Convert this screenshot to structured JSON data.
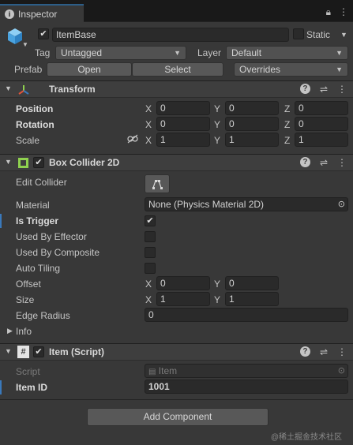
{
  "tab": {
    "title": "Inspector"
  },
  "gameobject": {
    "active": true,
    "name": "ItemBase",
    "static_label": "Static",
    "tag_label": "Tag",
    "tag_value": "Untagged",
    "layer_label": "Layer",
    "layer_value": "Default",
    "prefab_label": "Prefab",
    "open_label": "Open",
    "select_label": "Select",
    "overrides_label": "Overrides"
  },
  "transform": {
    "title": "Transform",
    "position_label": "Position",
    "rotation_label": "Rotation",
    "scale_label": "Scale",
    "position": {
      "x": "0",
      "y": "0",
      "z": "0"
    },
    "rotation": {
      "x": "0",
      "y": "0",
      "z": "0"
    },
    "scale": {
      "x": "1",
      "y": "1",
      "z": "1"
    },
    "axis": {
      "x": "X",
      "y": "Y",
      "z": "Z"
    }
  },
  "box_collider": {
    "title": "Box Collider 2D",
    "enabled": true,
    "edit_collider_label": "Edit Collider",
    "material_label": "Material",
    "material_value": "None (Physics Material 2D)",
    "is_trigger_label": "Is Trigger",
    "is_trigger": true,
    "used_by_effector_label": "Used By Effector",
    "used_by_composite_label": "Used By Composite",
    "auto_tiling_label": "Auto Tiling",
    "offset_label": "Offset",
    "offset": {
      "x": "0",
      "y": "0"
    },
    "size_label": "Size",
    "size": {
      "x": "1",
      "y": "1"
    },
    "edge_radius_label": "Edge Radius",
    "edge_radius": "0",
    "info_label": "Info"
  },
  "item_script": {
    "title": "Item (Script)",
    "enabled": true,
    "script_label": "Script",
    "script_value": "Item",
    "item_id_label": "Item ID",
    "item_id_value": "1001"
  },
  "add_component_label": "Add Component",
  "watermark": "@稀土掘金技术社区",
  "colors": {
    "background": "#383838",
    "accent_blue": "#3a79bb",
    "collider_green": "#8fd14f",
    "transform_red": "#e0533a"
  }
}
